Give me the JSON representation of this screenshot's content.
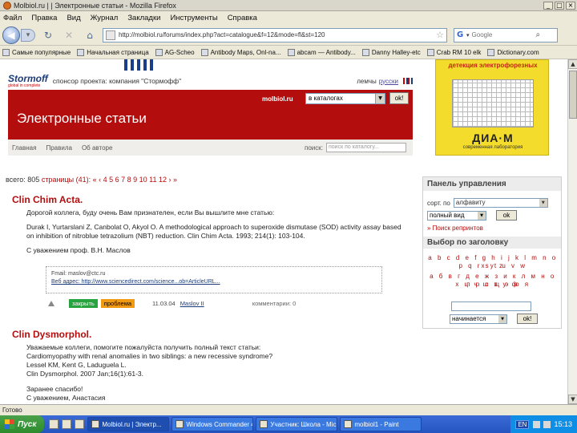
{
  "window": {
    "title": "Molbiol.ru | | Электронные статьи - Mozilla Firefox",
    "buttons": [
      "_",
      "□",
      "×"
    ]
  },
  "menu": [
    "Файл",
    "Правка",
    "Вид",
    "Журнал",
    "Закладки",
    "Инструменты",
    "Справка"
  ],
  "nav": {
    "back_icon": "arrow-left-icon",
    "fwd_glyph": "▾",
    "url": "http://molbiol.ru/forums/index.php?act=catalogue&f=12&mode=fl&st=120",
    "search_placeholder": "Google"
  },
  "bookmarks": [
    "Самые популярные",
    "Начальная страница",
    "AG-Scheo",
    "Antibody Maps, Onl-na...",
    "abcam — Antibody...",
    "Danny Halley-etc",
    "Crab RM 10 elk",
    "Dictionary.com"
  ],
  "ad": {
    "heading": "детекция\nэлектрофорезных",
    "brand": "ДИА·М",
    "sub": "современная лаборатория",
    "accent": "#f4dc2c"
  },
  "header": {
    "logo_name": "Stormoff",
    "logo_tag": "global in complete",
    "sponsor": "спонсор проекта: компания \"Стормофф\"",
    "lang_label": "лемчы",
    "lang_link": "русски",
    "site_label": "molbiol.ru",
    "site_select": "в каталогах",
    "ok": "ok!",
    "page_heading": "Электронные статьи",
    "brand_color": "#b40d0d"
  },
  "navrow": {
    "links": [
      "Главная",
      "Правила",
      "Об авторе"
    ],
    "search_label": "поиск:",
    "search_placeholder": "поиск по каталогу..."
  },
  "pagination": {
    "total": "всего: 805",
    "pages": "страницы (41): « ‹ 4 5 6 7 8 9 10 11 12 › »"
  },
  "articles": [
    {
      "title": "Clin Chim Acta.",
      "paragraphs": [
        "Дорогой коллега, буду очень Вам признателен, если Вы вышлите мне статью:",
        "Durak I, Yurtarslani Z, Canbolat O, Akyol O. A methodological approach to superoxide dismutase (SOD) activity assay based on inhibition of nitroblue tetrazolium (NBT) reduction. Clin Chim Acta. 1993; 214(1): 103-104.",
        "С уважением проф. В.Н. Маслов"
      ],
      "sig_lines": [
        "Fmail: maslov@ctc.ru",
        "Веб адрес: http://www.sciencedirect.com/science...ob=ArticleURL..."
      ],
      "actions": {
        "closed": "закрыть",
        "problem": "проблема",
        "date": "11.03.04",
        "author": "Maslov II",
        "comments": "комментарии: 0"
      }
    },
    {
      "title": "Clin Dysmorphol.",
      "paragraphs": [
        "Уважаемые коллеги, помогите пожалуйста получить полный текст статьи:",
        "Cardiomyopathy with renal anomalies in two siblings: a new recessive syndrome?",
        "Lessel KM, Kent G, Laduguela L.",
        "Clin Dysmorphol. 2007 Jan;16(1):61-3.",
        "Заранее спасибо!",
        "С уважением, Анастасия"
      ]
    }
  ],
  "panel": {
    "title": "Панель управления",
    "sort_label": "сорт. по",
    "sort_value": "алфавиту",
    "view_value": "полный вид",
    "ok": "ok",
    "reprint": "» Поиск репринтов",
    "section": "Выбор по заголовку",
    "letters_latin": [
      "a b c d e f g h i j k l m n o p q r s t u v w",
      "x y z"
    ],
    "letters_cyr": [
      "а б в г д е ж з и к л м н о п р с т у ф",
      "х ц ч ш щ э ю я"
    ],
    "mode_value": "начинается",
    "search_ok": "ok!"
  },
  "status": "Готово",
  "taskbar": {
    "start": "Пуск",
    "tasks": [
      {
        "label": "Molbiol.ru | Электр...",
        "active": true
      },
      {
        "label": "Windows Commander 4...",
        "active": false
      },
      {
        "label": "Участник: Школа - Mic...",
        "active": false
      },
      {
        "label": "molbiol1 - Paint",
        "active": false
      }
    ],
    "lang": "EN",
    "clock": "15:13"
  }
}
